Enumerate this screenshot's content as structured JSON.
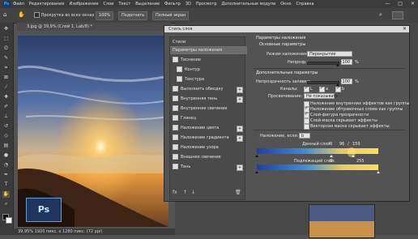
{
  "menu": {
    "logo": "Ps",
    "items": [
      "Файл",
      "Редактирование",
      "Изображение",
      "Слои",
      "Текст",
      "Выделение",
      "Фильтр",
      "3D",
      "Просмотр",
      "Дополнительные модули",
      "Окно",
      "Справка"
    ]
  },
  "window_controls": [
    "—",
    "□",
    "✕"
  ],
  "options": {
    "scroll_all": "Прокрутка во всех окнах",
    "zoom": "100%",
    "fit": "Подогнать",
    "fullscreen": "Полный экран"
  },
  "doc": {
    "tab": "3.jpg @ 39,9% (Слой 1, Lab/8) *",
    "status": "39,95%  1920 пикс. x 1280 пикс. (72 ppi)"
  },
  "dialog": {
    "title": "Стиль слоя",
    "styles_header": "Стили",
    "blending_options": "Параметры наложения",
    "styles": [
      {
        "label": "Тиснение",
        "plus": false
      },
      {
        "label": "Контур",
        "plus": false,
        "indent": true
      },
      {
        "label": "Текстура",
        "plus": false,
        "indent": true
      },
      {
        "label": "Выполнить обводку",
        "plus": true
      },
      {
        "label": "Внутренняя тень",
        "plus": true
      },
      {
        "label": "Внутреннее свечение",
        "plus": false
      },
      {
        "label": "Глянец",
        "plus": false
      },
      {
        "label": "Наложение цвета",
        "plus": true
      },
      {
        "label": "Наложение градиента",
        "plus": true
      },
      {
        "label": "Наложение узора",
        "plus": false
      },
      {
        "label": "Внешнее свечение",
        "plus": false
      },
      {
        "label": "Тень",
        "plus": true
      }
    ],
    "footer_icons": [
      "fx",
      "↑",
      "↓",
      "🗑"
    ],
    "blend": {
      "title": "Параметры наложения",
      "general": "Основные параметры",
      "mode_label": "Режим наложения:",
      "mode_value": "Перекрытие",
      "opacity_label": "Непрозр.:",
      "opacity_value": "100",
      "percent": "%",
      "advanced": "Дополнительные параметры",
      "fill_label": "Непрозрачность заливки:",
      "fill_value": "100",
      "channels_label": "Каналы:",
      "channels": [
        "L",
        "a",
        "b"
      ],
      "knockout_label": "Просвечивание:",
      "knockout_value": "Не показывать",
      "checks": [
        {
          "label": "Наложение внутренних эффектов как группы",
          "on": false
        },
        {
          "label": "Наложение обтравочных слоев как группы",
          "on": true
        },
        {
          "label": "Слой-фигура прозрачности",
          "on": true
        },
        {
          "label": "Слой-маска скрывает эффекты",
          "on": false
        },
        {
          "label": "Векторная маска скрывает эффекты",
          "on": false
        }
      ],
      "blend_if_label": "Наложение, если:",
      "blend_if_value": "b",
      "this_layer_label": "Данный слой:",
      "this_layer_low": "0",
      "this_layer_mid": "96",
      "this_layer_sep": "/",
      "this_layer_high": "159",
      "underlying_label": "Подлежащий слой:",
      "underlying_low": "0",
      "underlying_high": "255"
    }
  },
  "colors": {
    "accent": "#31a8ff",
    "dialog_bg": "#535353",
    "menubar": "#3c3c3c"
  }
}
